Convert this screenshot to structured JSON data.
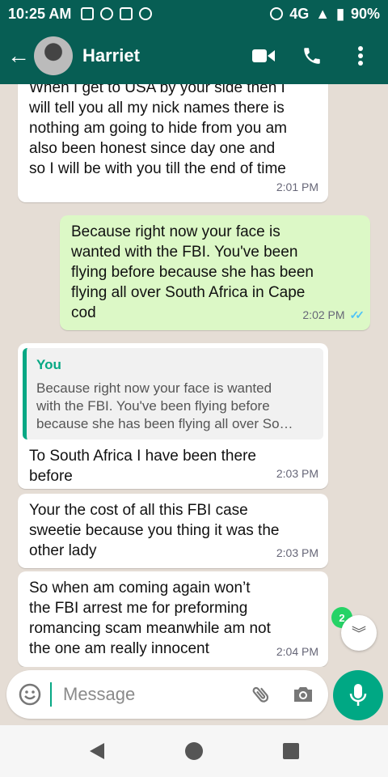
{
  "status_bar": {
    "time": "10:25 AM",
    "battery": "90%",
    "signal_text": "4G"
  },
  "header": {
    "contact_name": "Harriet",
    "avatar_icon": "contact-avatar",
    "back_icon": "arrow-left-icon",
    "actions": [
      "video-call-icon",
      "phone-call-icon",
      "more-vert-icon"
    ]
  },
  "messages": [
    {
      "direction": "in",
      "text": "When I get to USA by your side then I\nwill tell you all my nick names there is\nnothing am going to hide from you am\nalso been honest since day one and\nso I will be with you till the end of time",
      "time": "2:01 PM"
    },
    {
      "direction": "out",
      "text": "Because right now your face is\nwanted with the FBI. You've been\nflying before because she has been\nflying all over South Africa in Cape\ncod",
      "time": "2:02 PM",
      "status": "read"
    },
    {
      "direction": "in",
      "quote": {
        "author": "You",
        "text": "Because right now your face is wanted\nwith the FBI. You've been flying before\nbecause she has been flying all over So…"
      },
      "text": "To South Africa I have been there\nbefore",
      "time": "2:03 PM"
    },
    {
      "direction": "in",
      "text": "Your the cost of all this FBI case\nsweetie because you thing it was the\nother lady",
      "time": "2:03 PM"
    },
    {
      "direction": "in",
      "text": "So when am coming again won’t\nthe FBI arrest me for preforming\nromancing scam meanwhile am not\nthe one am really innocent",
      "time": "2:04 PM"
    }
  ],
  "unread_count": "2",
  "composer": {
    "placeholder": "Message",
    "value": ""
  },
  "colors": {
    "header": "#075e54",
    "accent": "#00a884",
    "outgoing_bubble": "#dcf8c6",
    "incoming_bubble": "#ffffff",
    "chat_background": "#e5ddd5",
    "read_ticks": "#4fc3f7"
  }
}
